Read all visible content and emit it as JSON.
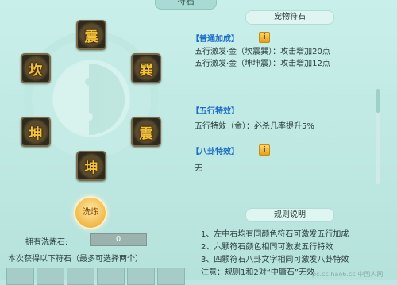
{
  "top_tab": {
    "label": "符石"
  },
  "bagua": {
    "runes": [
      {
        "char": "震",
        "pos": "top"
      },
      {
        "char": "巽",
        "pos": "top-right"
      },
      {
        "char": "坎",
        "pos": "top-left"
      },
      {
        "char": "震",
        "pos": "bottom-right"
      },
      {
        "char": "坤",
        "pos": "bottom-left"
      },
      {
        "char": "坤",
        "pos": "bottom"
      }
    ]
  },
  "controls": {
    "wash_button": "洗炼",
    "owned_label": "拥有洗炼石:",
    "owned_value": "0",
    "hint": "本次获得以下符石（最多可选择两个）"
  },
  "pet_rune": {
    "header": "宠物符石",
    "general_tag": "【普通加成】",
    "general_lines": [
      "五行激发·金（坎震巽）：攻击增加20点",
      "五行激发·金（坤坤震）：攻击增加12点"
    ],
    "wuxing_tag": "【五行特效】",
    "wuxing_line": "五行特效（金）：必杀几率提升5%",
    "bagua_tag": "【八卦特效】",
    "bagua_line": "无"
  },
  "rules": {
    "header": "规则说明",
    "lines": [
      "1、左中右均有同颜色符石可激发五行加成",
      "2、六颗符石颜色相同可激发五行特效",
      "3、四颗符石八卦文字相同可激发八卦特效",
      "注意：规则1和2对“中庸石”无效"
    ]
  },
  "watermark": "pc.cc.hao6.cc 中国人网"
}
